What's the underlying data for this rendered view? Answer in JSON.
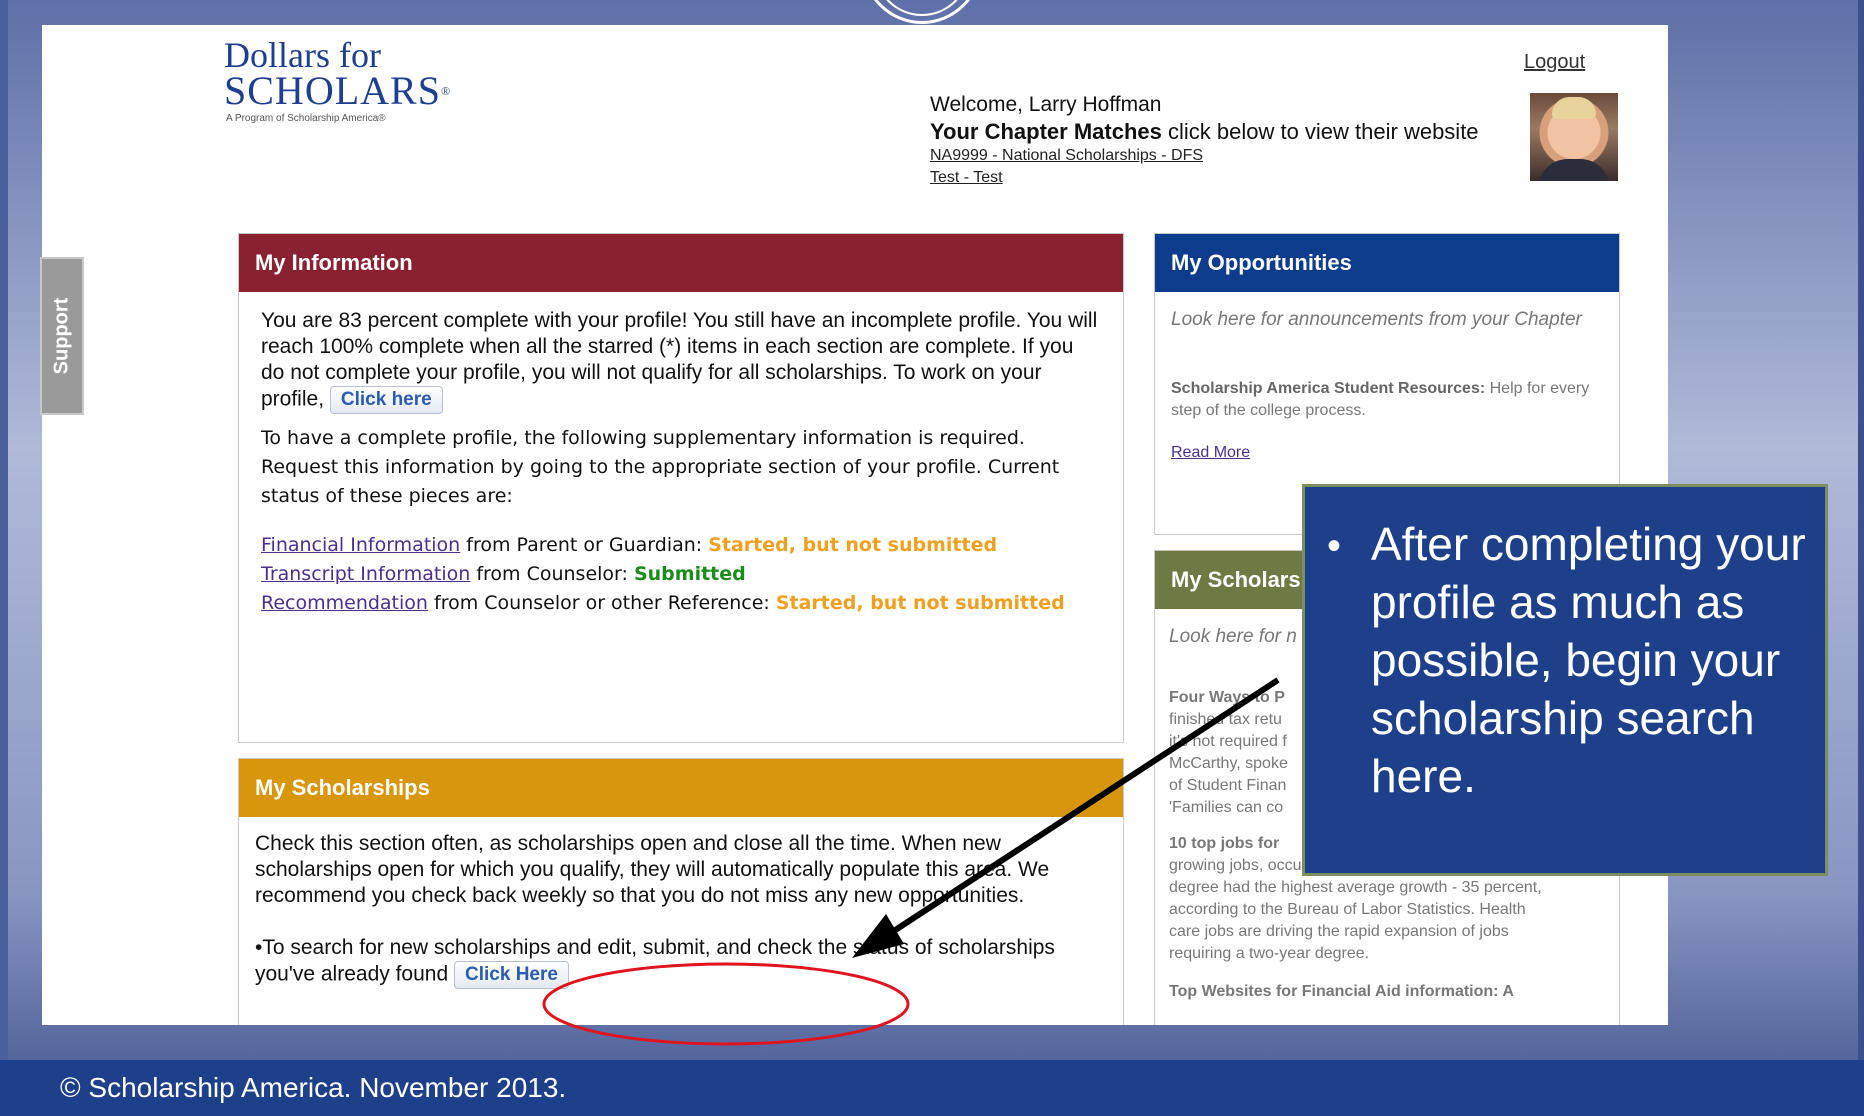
{
  "logo": {
    "line1": "Dollars for",
    "line2": "SCHOLARS",
    "reg": "®",
    "tagline": "A Program of Scholarship America®"
  },
  "header": {
    "logout": "Logout",
    "welcome": "Welcome, Larry Hoffman",
    "matches_bold": "Your Chapter Matches",
    "matches_rest": " click below to view their website",
    "chapters": [
      "NA9999 - National Scholarships - DFS",
      "Test - Test"
    ]
  },
  "support_tab": "Support",
  "my_information": {
    "title": "My Information",
    "intro": "You are 83 percent complete with your profile! You still have an incomplete profile. You will reach 100% complete when all the starred (*) items in each section are complete. If you do not complete your profile, you will not qualify for all scholarships. To work on your profile,",
    "click_here": "Click here",
    "supplementary": "To have a complete profile, the following supplementary information is required. Request this information by going to the appropriate section of your profile. Current status of these pieces are:",
    "items": [
      {
        "link": "Financial Information",
        "from": " from Parent or Guardian: ",
        "status": "Started, but not submitted",
        "status_type": "orange"
      },
      {
        "link": "Transcript Information",
        "from": " from Counselor: ",
        "status": "Submitted",
        "status_type": "green"
      },
      {
        "link": "Recommendation",
        "from": " from Counselor or other Reference: ",
        "status": "Started, but not submitted",
        "status_type": "orange"
      }
    ]
  },
  "my_scholarships": {
    "title": "My Scholarships",
    "body": "Check this section often, as scholarships open and close all the time.  When new scholarships open for which you qualify, they will automatically populate this area.  We recommend you check back weekly so that you do not miss any new opportunities.",
    "search_text": "•To search for new scholarships and edit, submit, and check the status of scholarships you've already found",
    "click_here": "Click Here"
  },
  "my_opportunities": {
    "title": "My Opportunities",
    "intro": "Look here for announcements from your Chapter",
    "resource_bold": "Scholarship America Student Resources:",
    "resource_rest": " Help for every step of the college process.",
    "read_more": "Read More"
  },
  "my_scholarship_news": {
    "title": "My Scholars",
    "intro": "Look here for n",
    "news_lines": [
      "Four Ways to P",
      "finished tax retu",
      "it's not required f",
      "McCarthy, spoke",
      "of Student Finan",
      "'Families can co"
    ],
    "jobs_bold": "10 top jobs for",
    "jobs_lines": [
      "growing jobs, occupations requiring an associate's",
      "degree had the highest average growth - 35 percent,",
      "according to the Bureau of Labor Statistics. Health",
      "care jobs are driving the rapid expansion of jobs",
      "requiring a two-year degree."
    ],
    "cutoff": "Top Websites for Financial Aid information: A"
  },
  "callout": {
    "bullet": "•",
    "text": "After completing your profile as much as possible, begin your scholarship search here."
  },
  "footer": "© Scholarship America. November 2013.",
  "colors": {
    "info_header": "#8a2131",
    "opportunities_header": "#0e3c8c",
    "scholarships_header": "#d8960c",
    "news_header": "#6e7a43",
    "callout_bg": "#1e3f8a",
    "annotation_circle": "#e0141e"
  }
}
